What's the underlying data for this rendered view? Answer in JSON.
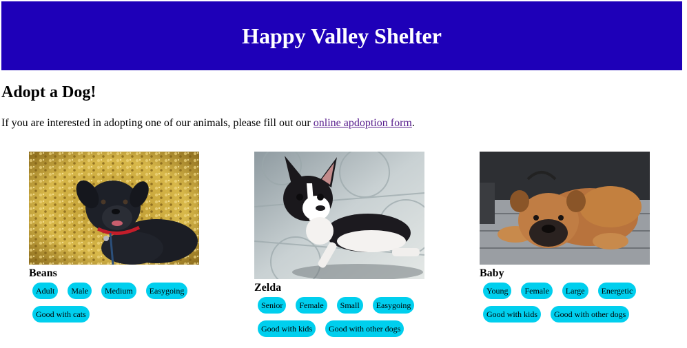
{
  "header": {
    "title": "Happy Valley Shelter"
  },
  "main": {
    "heading": "Adopt a Dog!",
    "intro_prefix": "If you are interested in adopting one of our animals, please fill out our ",
    "intro_link": "online apdoption form",
    "intro_suffix": "."
  },
  "dogs": [
    {
      "name": "Beans",
      "tags": [
        "Adult",
        "Male",
        "Medium",
        "Easygoing",
        "Good with cats"
      ]
    },
    {
      "name": "Zelda",
      "tags": [
        "Senior",
        "Female",
        "Small",
        "Easygoing",
        "Good with kids",
        "Good with other dogs"
      ]
    },
    {
      "name": "Baby",
      "tags": [
        "Young",
        "Female",
        "Large",
        "Energetic",
        "Good with kids",
        "Good with other dogs"
      ]
    }
  ],
  "colors": {
    "banner": "#1e00b8",
    "tag": "#00cfee",
    "link": "#551a8b"
  }
}
